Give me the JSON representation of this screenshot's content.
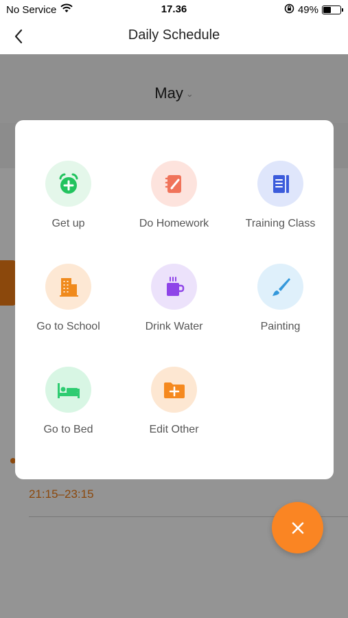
{
  "status_bar": {
    "carrier": "No Service",
    "time": "17.36",
    "battery_percent": "49%",
    "battery_level": 0.49
  },
  "nav": {
    "title": "Daily Schedule"
  },
  "calendar": {
    "month": "May"
  },
  "schedule_entry": {
    "time_range": "21:15–23:15"
  },
  "modal": {
    "items": [
      {
        "label": "Get up",
        "icon": "alarm-clock-icon",
        "bg": "#e4f7ea",
        "color": "#22c35e"
      },
      {
        "label": "Do Homework",
        "icon": "notebook-pencil-icon",
        "bg": "#fde3dd",
        "color": "#f0735a"
      },
      {
        "label": "Training Class",
        "icon": "book-icon",
        "bg": "#dfe6fb",
        "color": "#3b5bdb"
      },
      {
        "label": "Go to School",
        "icon": "school-building-icon",
        "bg": "#fde8d4",
        "color": "#f08a1c"
      },
      {
        "label": "Drink Water",
        "icon": "mug-icon",
        "bg": "#ece2fb",
        "color": "#8e44e8"
      },
      {
        "label": "Painting",
        "icon": "paintbrush-icon",
        "bg": "#dff0fb",
        "color": "#3498db"
      },
      {
        "label": "Go to Bed",
        "icon": "bed-icon",
        "bg": "#d8f6e4",
        "color": "#2ecc71"
      },
      {
        "label": "Edit Other",
        "icon": "folder-plus-icon",
        "bg": "#fde7d2",
        "color": "#f5891f"
      }
    ]
  },
  "colors": {
    "accent": "#fa8523",
    "overlay": "rgba(0,0,0,0.42)"
  }
}
